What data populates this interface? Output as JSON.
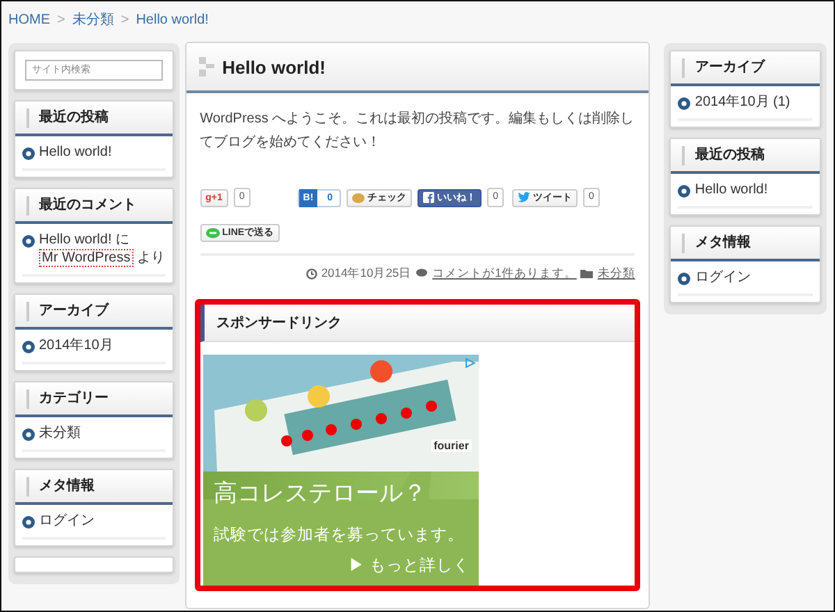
{
  "breadcrumb": {
    "separator": ">",
    "items": [
      {
        "label": "HOME"
      },
      {
        "label": "未分類"
      },
      {
        "label": "Hello world!"
      }
    ]
  },
  "sidebar_left": {
    "widgets": [
      {
        "kind": "search",
        "placeholder": "サイト内検索"
      },
      {
        "kind": "list",
        "title": "最近の投稿",
        "items": [
          {
            "kind": "link",
            "text": "Hello world!"
          }
        ]
      },
      {
        "kind": "list",
        "title": "最近のコメント",
        "items": [
          {
            "kind": "comment",
            "post": "Hello world!",
            "connector": "に",
            "author": "Mr WordPress",
            "tail": "より",
            "author_highlighted": true
          }
        ]
      },
      {
        "kind": "list",
        "title": "アーカイブ",
        "items": [
          {
            "kind": "link",
            "text": "2014年10月"
          }
        ]
      },
      {
        "kind": "list",
        "title": "カテゴリー",
        "items": [
          {
            "kind": "link",
            "text": "未分類"
          }
        ]
      },
      {
        "kind": "list",
        "title": "メタ情報",
        "items": [
          {
            "kind": "link",
            "text": "ログイン"
          }
        ]
      },
      {
        "kind": "empty"
      }
    ]
  },
  "post": {
    "title": "Hello world!",
    "body": "WordPress へようこそ。これは最初の投稿です。編集もしくは削除してブログを始めてください！",
    "share_buttons": [
      {
        "kind": "gplus",
        "label": "g+1",
        "count": "0"
      },
      {
        "kind": "hatebu",
        "label": "B!",
        "count": "0"
      },
      {
        "kind": "check",
        "label": "チェック"
      },
      {
        "kind": "facebook",
        "label": "いいね！",
        "count": "0"
      },
      {
        "kind": "twitter",
        "label": "ツイート",
        "count": "0"
      },
      {
        "kind": "line",
        "label": "LINEで送る"
      }
    ],
    "meta": {
      "date": "2014年10月25日",
      "comments": "コメントが1件あります。",
      "category": "未分類"
    }
  },
  "sponsor": {
    "title": "スポンサードリンク",
    "highlighted": true,
    "ad": {
      "headline": "高コレステロール？",
      "subline": "試験では参加者を募っています。",
      "more": "▶ もっと詳しく",
      "brand": "fourier"
    }
  },
  "sidebar_right": {
    "widgets": [
      {
        "kind": "list",
        "title": "アーカイブ",
        "items": [
          {
            "kind": "link",
            "text": "2014年10月 (1)"
          }
        ]
      },
      {
        "kind": "list",
        "title": "最近の投稿",
        "items": [
          {
            "kind": "link",
            "text": "Hello world!"
          }
        ]
      },
      {
        "kind": "list",
        "title": "メタ情報",
        "items": [
          {
            "kind": "link",
            "text": "ログイン"
          }
        ]
      }
    ]
  }
}
